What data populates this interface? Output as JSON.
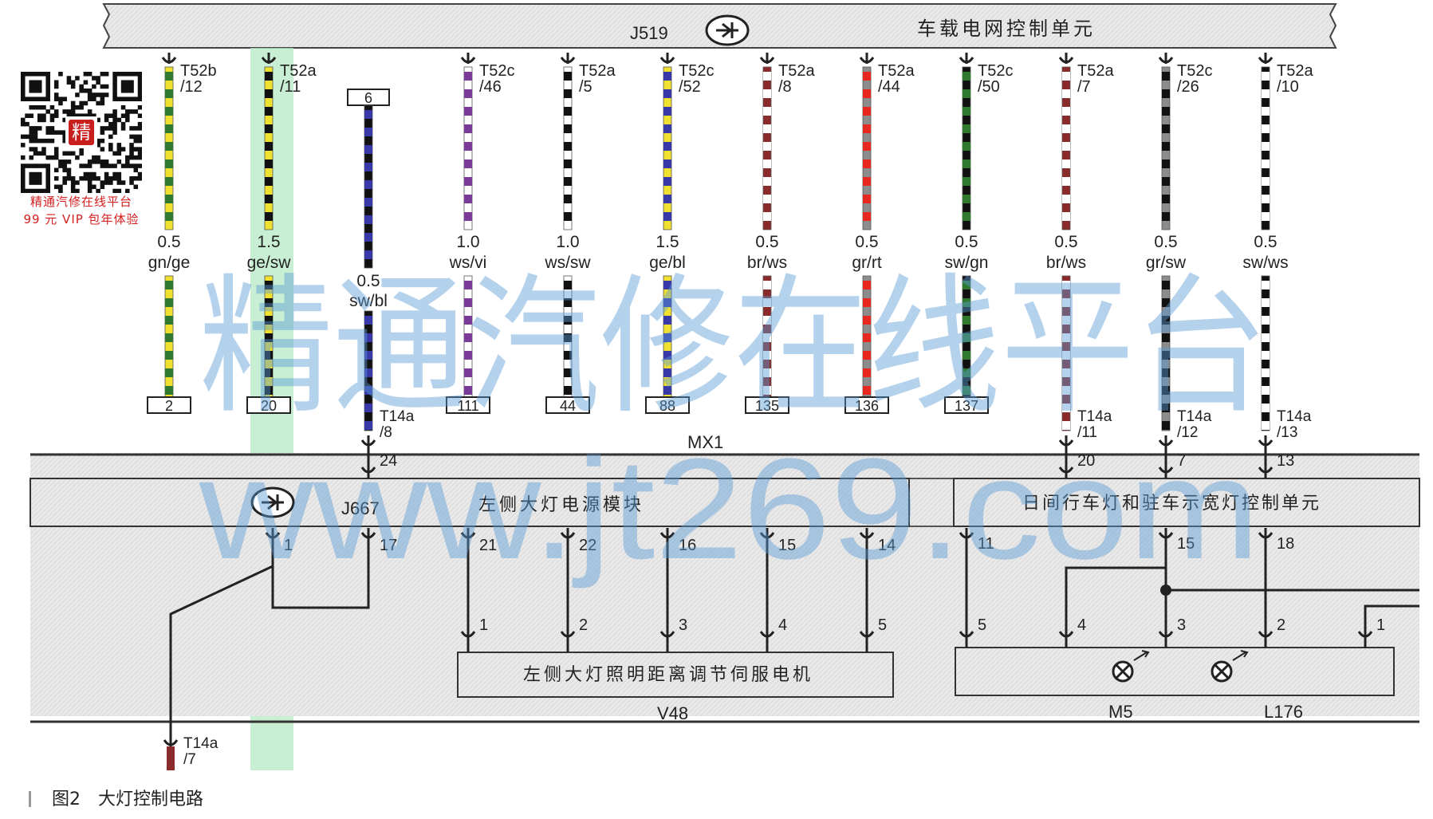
{
  "top_module": {
    "code": "J519",
    "name": "车载电网控制单元"
  },
  "upper_wires": [
    {
      "pin_connector": "T52b",
      "pin_no": "/12",
      "size": "0.5",
      "color_code": "gn/ge",
      "connector_no": "2",
      "base": "#f0e030",
      "stripe": "#2f7a2f"
    },
    {
      "pin_connector": "T52a",
      "pin_no": "/11",
      "size": "1.5",
      "color_code": "ge/sw",
      "connector_no": "20",
      "base": "#f0e030",
      "stripe": "#111111"
    },
    {
      "pin_connector": "",
      "pin_no": "",
      "size": "0.5",
      "color_code": "sw/bl",
      "connector_no": "6",
      "base": "#111111",
      "stripe": "#3838a8"
    },
    {
      "pin_connector": "T52c",
      "pin_no": "/46",
      "size": "1.0",
      "color_code": "ws/vi",
      "connector_no": "111",
      "base": "#ffffff",
      "stripe": "#7a3a98"
    },
    {
      "pin_connector": "T52a",
      "pin_no": "/5",
      "size": "1.0",
      "color_code": "ws/sw",
      "connector_no": "44",
      "base": "#ffffff",
      "stripe": "#111111"
    },
    {
      "pin_connector": "T52c",
      "pin_no": "/52",
      "size": "1.5",
      "color_code": "ge/bl",
      "connector_no": "88",
      "base": "#f0e030",
      "stripe": "#3838a8"
    },
    {
      "pin_connector": "T52a",
      "pin_no": "/8",
      "size": "0.5",
      "color_code": "br/ws",
      "connector_no": "135",
      "base": "#8a2a2a",
      "stripe": "#ffffff"
    },
    {
      "pin_connector": "T52a",
      "pin_no": "/44",
      "size": "0.5",
      "color_code": "gr/rt",
      "connector_no": "136",
      "base": "#8c8c8c",
      "stripe": "#e8281e"
    },
    {
      "pin_connector": "T52c",
      "pin_no": "/50",
      "size": "0.5",
      "color_code": "sw/gn",
      "connector_no": "137",
      "base": "#111111",
      "stripe": "#2f7a2f"
    },
    {
      "pin_connector": "T52a",
      "pin_no": "/7",
      "size": "0.5",
      "color_code": "br/ws",
      "connector_no": "",
      "base": "#8a2a2a",
      "stripe": "#ffffff"
    },
    {
      "pin_connector": "T52c",
      "pin_no": "/26",
      "size": "0.5",
      "color_code": "gr/sw",
      "connector_no": "",
      "base": "#8c8c8c",
      "stripe": "#111111"
    },
    {
      "pin_connector": "T52a",
      "pin_no": "/10",
      "size": "0.5",
      "color_code": "sw/ws",
      "connector_no": "",
      "base": "#111111",
      "stripe": "#ffffff"
    }
  ],
  "mx1": {
    "label": "MX1",
    "t14a_pins": [
      {
        "connector": "T14a",
        "pin": "/8",
        "num": "24"
      },
      {
        "connector": "T14a",
        "pin": "/11",
        "num": "20"
      },
      {
        "connector": "T14a",
        "pin": "/12",
        "num": "7"
      },
      {
        "connector": "T14a",
        "pin": "/13",
        "num": "13"
      }
    ]
  },
  "j667": {
    "code": "J667",
    "name": "左侧大灯电源模块",
    "pins": [
      "1",
      "17",
      "21",
      "22",
      "16",
      "15",
      "14"
    ]
  },
  "drl_module": {
    "name": "日间行车灯和驻车示宽灯控制单元",
    "pins": [
      "11",
      "15",
      "18"
    ]
  },
  "v48": {
    "code": "V48",
    "name": "左侧大灯照明距离调节伺服电机",
    "pins": [
      "1",
      "2",
      "3",
      "4",
      "5"
    ]
  },
  "lamp_unit": {
    "labels": [
      "M5",
      "L176"
    ],
    "pins": [
      "5",
      "4",
      "3",
      "2",
      "1"
    ]
  },
  "bottom_pin": {
    "connector": "T14a",
    "pin": "/7"
  },
  "qr_caption": [
    "精通汽修在线平台",
    "99 元 VIP 包年体验"
  ],
  "qr_badge": "精",
  "figure_caption": {
    "number": "图2",
    "title": "大灯控制电路"
  },
  "watermark": {
    "line1": "精通汽修在线平台",
    "line2": "www.jt269.com"
  }
}
